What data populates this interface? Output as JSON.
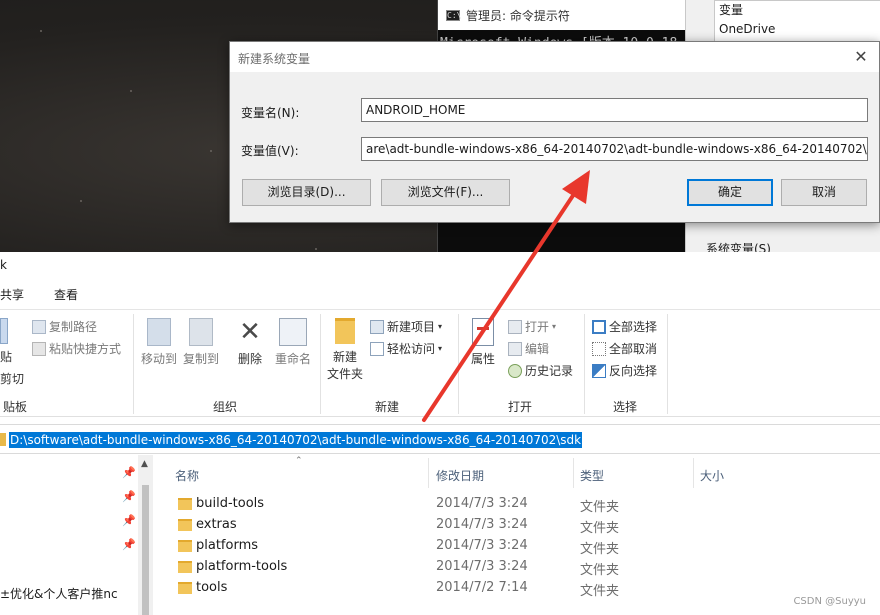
{
  "cmd": {
    "title": "管理员: 命令提示符",
    "icon_text": "C:\\",
    "line1": "Microsoft Windows [版本 10.0.18"
  },
  "env_panel": {
    "row1": "变量",
    "row2": "OneDrive",
    "system_vars": "系统变量(S)"
  },
  "dialog": {
    "title": "新建系统变量",
    "close_icon": "close-icon",
    "name_label": "变量名(N):",
    "name_value": "ANDROID_HOME",
    "value_label": "变量值(V):",
    "value_value": "are\\adt-bundle-windows-x86_64-20140702\\adt-bundle-windows-x86_64-20140702\\sdk",
    "browse_dir": "浏览目录(D)...",
    "browse_file": "浏览文件(F)...",
    "ok": "确定",
    "cancel": "取消"
  },
  "explorer": {
    "title": "k",
    "tabs": [
      "共享",
      "查看"
    ],
    "ribbon": {
      "paste_part1": "贴",
      "cut": "剪切",
      "copy_path": "复制路径",
      "paste_shortcut": "粘贴快捷方式",
      "clipboard_label": "贴板",
      "move_to": "移动到",
      "copy_to": "复制到",
      "delete": "删除",
      "rename": "重命名",
      "organize_label": "组织",
      "new_folder_1": "新建",
      "new_folder_2": "文件夹",
      "new_item": "新建项目",
      "easy_access": "轻松访问",
      "new_label": "新建",
      "properties": "属性",
      "open": "打开",
      "edit": "编辑",
      "history": "历史记录",
      "open_label": "打开",
      "select_all": "全部选择",
      "select_none": "全部取消",
      "invert": "反向选择",
      "select_label": "选择"
    },
    "address": "D:\\software\\adt-bundle-windows-x86_64-20140702\\adt-bundle-windows-x86_64-20140702\\sdk",
    "nav_item": "±优化&个人客户推nc",
    "columns": {
      "name": "名称",
      "date": "修改日期",
      "type": "类型",
      "size": "大小"
    },
    "files": [
      {
        "name": "build-tools",
        "date": "2014/7/3 3:24",
        "type": "文件夹"
      },
      {
        "name": "extras",
        "date": "2014/7/3 3:24",
        "type": "文件夹"
      },
      {
        "name": "platforms",
        "date": "2014/7/3 3:24",
        "type": "文件夹"
      },
      {
        "name": "platform-tools",
        "date": "2014/7/3 3:24",
        "type": "文件夹"
      },
      {
        "name": "tools",
        "date": "2014/7/2 7:14",
        "type": "文件夹"
      }
    ]
  },
  "watermark": "CSDN @Suyyu",
  "colors": {
    "accent": "#0078d7",
    "arrow": "#e8372c",
    "folder": "#f2c55a"
  }
}
